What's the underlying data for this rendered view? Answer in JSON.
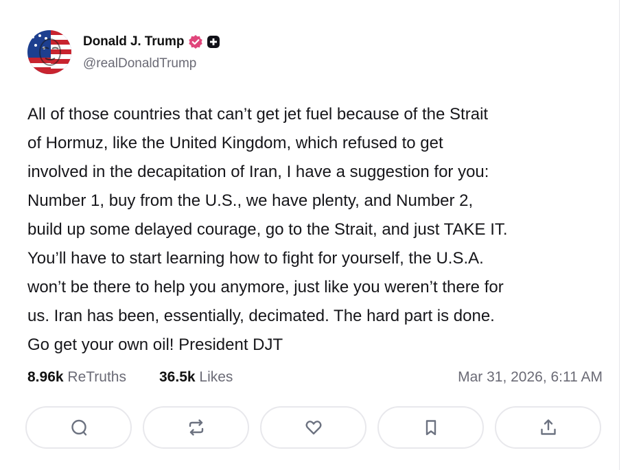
{
  "author": {
    "display_name": "Donald J. Trump",
    "handle": "@realDonaldTrump",
    "avatar_icon": "flag-face-avatar",
    "verified_icon": "verified-badge-icon",
    "plus_icon": "plus-badge-icon"
  },
  "post": {
    "text": "All of those countries that can’t get jet fuel because of the Strait\nof Hormuz, like the United Kingdom, which refused to get\ninvolved in the decapitation of Iran, I have a suggestion for you:\nNumber 1, buy from the U.S., we have plenty, and Number 2,\nbuild up some delayed courage, go to the Strait, and just TAKE IT.\nYou’ll have to start learning how to fight for yourself, the U.S.A.\nwon’t be there to help you anymore, just like you weren’t there for\nus. Iran has been, essentially, decimated. The hard part is done.\nGo get your own oil! President DJT",
    "timestamp": "Mar 31, 2026, 6:11 AM"
  },
  "stats": {
    "retruths_value": "8.96k",
    "retruths_label": "ReTruths",
    "likes_value": "36.5k",
    "likes_label": "Likes"
  },
  "actions": [
    {
      "name": "reply",
      "icon": "comment-icon"
    },
    {
      "name": "retruth",
      "icon": "repost-icon"
    },
    {
      "name": "like",
      "icon": "heart-icon"
    },
    {
      "name": "bookmark",
      "icon": "bookmark-icon"
    },
    {
      "name": "share",
      "icon": "share-icon"
    }
  ],
  "colors": {
    "verified_badge": "#e0457b",
    "text_primary": "#111111",
    "text_secondary": "#6a6a75",
    "button_border": "#e8e8ec"
  }
}
